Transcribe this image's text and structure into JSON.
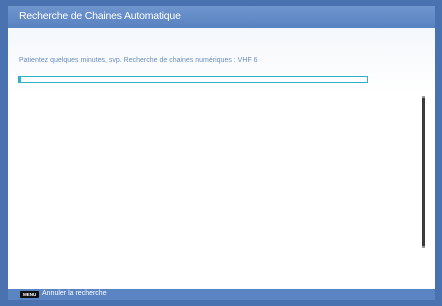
{
  "window": {
    "title": "Recherche de Chaines Automatique"
  },
  "main": {
    "status_text": "Patientez quelques minutes, svp. Recherche de chaines numériques : VHF 6"
  },
  "footer": {
    "menu_key_label": "MENU",
    "action_label": "Annuler la recherche"
  },
  "colors": {
    "frame_blue": "#4a72b0",
    "title_bar_blue": "#5882c0",
    "progress_accent": "#2fb0c8",
    "status_text": "#6b8fbd"
  }
}
